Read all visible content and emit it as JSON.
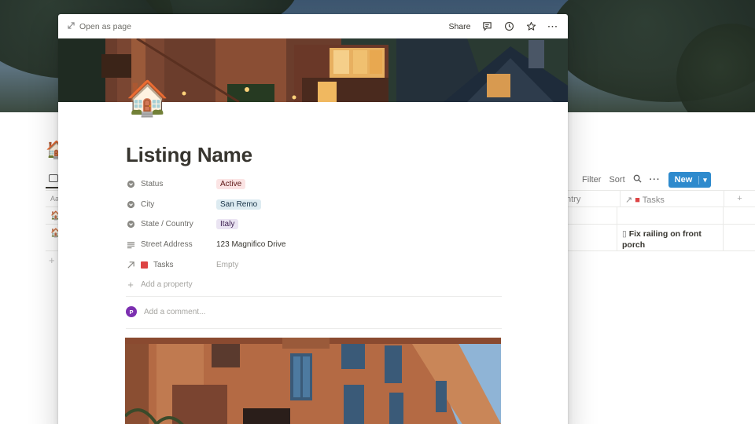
{
  "background": {
    "toolbar": {
      "filter": "Filter",
      "sort": "Sort",
      "new": "New"
    },
    "table": {
      "col_country_partial": "ntry",
      "col_tasks": "Tasks",
      "col_name_partial": "Aa",
      "row2_task": "Fix railing on front porch"
    }
  },
  "modal": {
    "topbar": {
      "open_as_page": "Open as page",
      "share": "Share"
    },
    "page_icon": "🏠",
    "title": "Listing Name",
    "properties": [
      {
        "name": "Status",
        "value": "Active",
        "icon": "status-icon"
      },
      {
        "name": "City",
        "value": "San Remo",
        "icon": "select-icon"
      },
      {
        "name": "State / Country",
        "value": "Italy",
        "icon": "select-icon"
      },
      {
        "name": "Street Address",
        "value": "123 Magnifico Drive",
        "icon": "text-icon"
      },
      {
        "name": "Tasks",
        "value": "Empty",
        "icon": "relation-icon"
      }
    ],
    "add_property": "Add a property",
    "comment": {
      "avatar_letter": "P",
      "placeholder": "Add a comment..."
    }
  },
  "colors": {
    "accent_blue": "#2e8acd",
    "tag_red": "#fbe4e4",
    "tag_blue": "#ddebf1",
    "tag_purple": "#eae4f2",
    "avatar": "#7c2fb0"
  }
}
